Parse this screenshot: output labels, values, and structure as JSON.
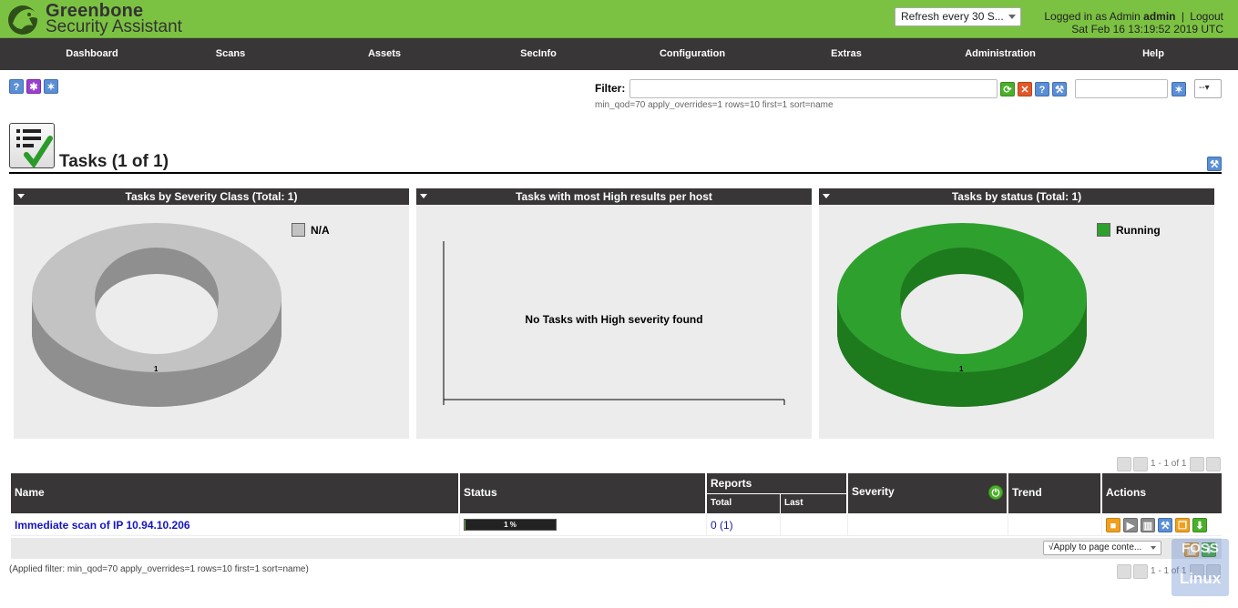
{
  "brand": {
    "line1": "Greenbone",
    "line2": "Security Assistant"
  },
  "header": {
    "refresh": "Refresh every 30 S...",
    "logged_in_as": "Logged in as",
    "role": "Admin",
    "username": "admin",
    "sep": "|",
    "logout": "Logout",
    "datetime": "Sat Feb 16 13:19:52 2019 UTC"
  },
  "nav": [
    {
      "label": "Dashboard"
    },
    {
      "label": "Scans"
    },
    {
      "label": "Assets"
    },
    {
      "label": "SecInfo"
    },
    {
      "label": "Configuration"
    },
    {
      "label": "Extras"
    },
    {
      "label": "Administration"
    },
    {
      "label": "Help"
    }
  ],
  "filter": {
    "label": "Filter:",
    "value": "",
    "hint": "min_qod=70 apply_overrides=1 rows=10 first=1 sort=name",
    "select": "--"
  },
  "page": {
    "title": "Tasks (1 of 1)"
  },
  "charts": [
    {
      "title": "Tasks by Severity Class (Total: 1)",
      "legend": "N/A",
      "slice_label": "1",
      "color": "#c3c3c3"
    },
    {
      "title": "Tasks with most High results per host",
      "empty": "No Tasks with High severity found"
    },
    {
      "title": "Tasks by status (Total: 1)",
      "legend": "Running",
      "slice_label": "1",
      "color": "#2ea02e"
    }
  ],
  "pagination": {
    "top": "1 - 1 of 1",
    "bottom": "1 - 1 of 1"
  },
  "table": {
    "headers": {
      "name": "Name",
      "status": "Status",
      "reports": "Reports",
      "total": "Total",
      "last": "Last",
      "severity": "Severity",
      "trend": "Trend",
      "actions": "Actions"
    },
    "rows": [
      {
        "name": "Immediate scan of IP 10.94.10.206",
        "progress_label": "1 %",
        "progress": 0.01,
        "reports_total": "0 (1)"
      }
    ],
    "apply_select": "√Apply to page conte...",
    "applied_filter": "(Applied filter: min_qod=70 apply_overrides=1 rows=10 first=1 sort=name)"
  },
  "watermark": {
    "line1": "FOSS",
    "line2": "Linux"
  }
}
